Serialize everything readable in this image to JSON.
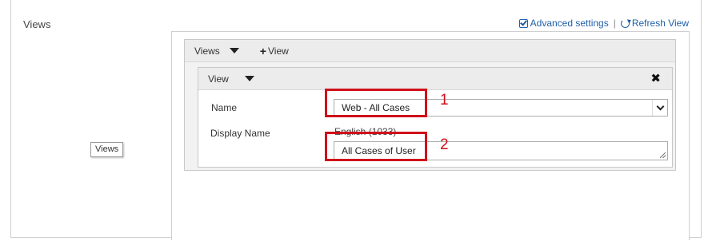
{
  "section": {
    "title": "Views"
  },
  "links": {
    "advanced": "Advanced settings",
    "separator": "|",
    "refresh": "Refresh View"
  },
  "tooltip": {
    "text": "Views"
  },
  "views_toolbar": {
    "dropdown_label": "Views",
    "add_label": "View",
    "add_icon": "plus-icon"
  },
  "view": {
    "header_label": "View",
    "close_icon": "close-icon",
    "name_label": "Name",
    "name_value": "Web - All Cases",
    "display_name_label": "Display Name",
    "language": "English (1033)",
    "display_name_value": "All Cases of User"
  },
  "annotations": {
    "color": "#d0101a",
    "marker_1": "1",
    "marker_2": "2"
  },
  "colors": {
    "link": "#1f5fa8",
    "border": "#cfcfcf",
    "toolbar_bg": "#ececec"
  }
}
